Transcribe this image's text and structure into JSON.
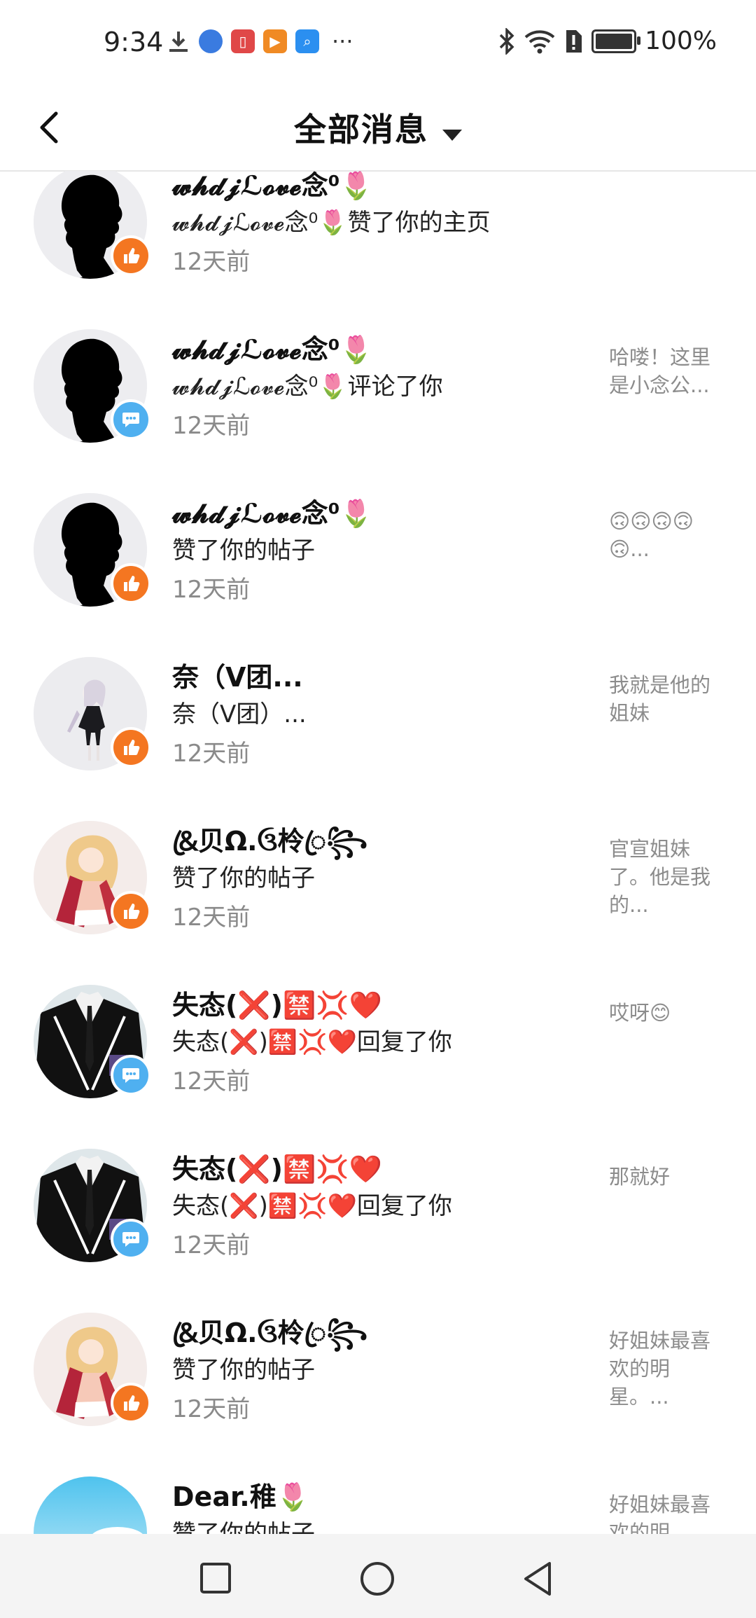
{
  "status_bar": {
    "time": "9:34",
    "notification_icons": [
      "download-icon",
      "browser-icon",
      "book-app-icon",
      "video-app-icon",
      "search-app-icon"
    ],
    "more": "···",
    "battery_text": "100%"
  },
  "header": {
    "back_icon": "chevron-left-icon",
    "title": "全部消息",
    "dropdown_icon": "caret-down-icon"
  },
  "messages": [
    {
      "name": "𝔀𝓱𝓭𝓳ℒ𝓸𝓿𝓮念⁰🌷",
      "action": "𝔀𝓱𝓭𝓳ℒ𝓸𝓿𝓮念⁰🌷赞了你的主页",
      "time": "12天前",
      "preview": "",
      "badge": "like",
      "avatar": "silhouette"
    },
    {
      "name": "𝔀𝓱𝓭𝓳ℒ𝓸𝓿𝓮念⁰🌷",
      "action": "𝔀𝓱𝓭𝓳ℒ𝓸𝓿𝓮念⁰🌷评论了你",
      "time": "12天前",
      "preview": "哈喽！这里是小念公...",
      "badge": "comment",
      "avatar": "silhouette"
    },
    {
      "name": "𝔀𝓱𝓭𝓳ℒ𝓸𝓿𝓮念⁰🌷",
      "action": "赞了你的帖子",
      "time": "12天前",
      "preview": "🙃🙃🙃🙃🙃...",
      "badge": "like",
      "avatar": "silhouette"
    },
    {
      "name": "奈（V团...",
      "action": "奈（V团）...",
      "time": "12天前",
      "preview": "我就是他的姐妹",
      "badge": "like",
      "avatar": "anime-white-hair"
    },
    {
      "name": "&ꦿ贝Ω.ઉ柃ꦿ꧂",
      "action": "赞了你的帖子",
      "time": "12天前",
      "preview": "官宣姐妹了。他是我的...",
      "badge": "like",
      "avatar": "anime-blonde"
    },
    {
      "name": "失态(❌)🈲💢❤️",
      "action": "失态(❌)🈲💢❤️回复了你",
      "time": "12天前",
      "preview": "哎呀😊",
      "badge": "comment",
      "avatar": "suit"
    },
    {
      "name": "失态(❌)🈲💢❤️",
      "action": "失态(❌)🈲💢❤️回复了你",
      "time": "12天前",
      "preview": "那就好",
      "badge": "comment",
      "avatar": "suit"
    },
    {
      "name": "&ꦿ贝Ω.ઉ柃ꦿ꧂",
      "action": "赞了你的帖子",
      "time": "12天前",
      "preview": "好姐妹最喜欢的明星。...",
      "badge": "like",
      "avatar": "anime-blonde"
    },
    {
      "name": "Dear.稚🌷",
      "action": "赞了你的帖子",
      "time": "",
      "preview": "好姐妹最喜欢的明",
      "badge": "",
      "avatar": "sky"
    }
  ],
  "nav_bar": {
    "recents_icon": "square-icon",
    "home_icon": "circle-icon",
    "back_icon": "triangle-back-icon"
  },
  "colors": {
    "like_badge": "#f47621",
    "comment_badge": "#4fb0f0",
    "muted_text": "#8a8a8a"
  }
}
